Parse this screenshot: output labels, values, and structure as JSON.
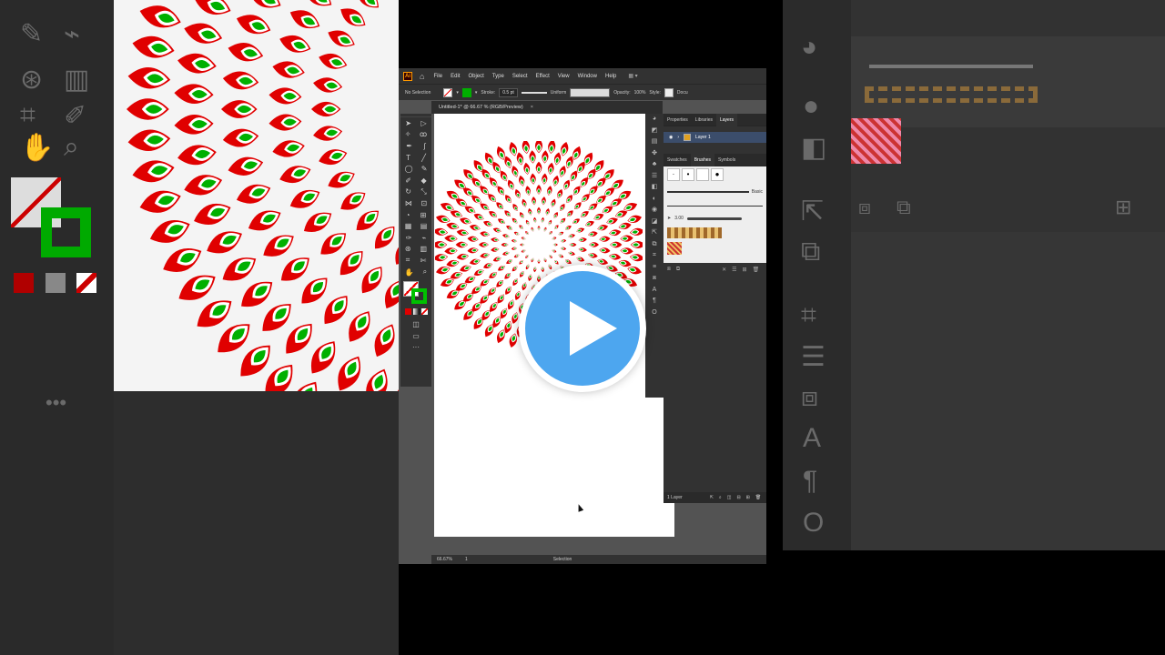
{
  "menubar": {
    "logo": "Ai",
    "items": [
      "File",
      "Edit",
      "Object",
      "Type",
      "Select",
      "Effect",
      "View",
      "Window",
      "Help"
    ]
  },
  "controlbar": {
    "selection": "No Selection",
    "stroke_label": "Stroke:",
    "stroke_value": "0.5 pt",
    "profile": "Uniform",
    "opacity_label": "Opacity:",
    "opacity_value": "100%",
    "style_label": "Style:",
    "doc_label": "Docu"
  },
  "document_tab": {
    "title": "Untitled-1* @ 66.67 % (RGB/Preview)",
    "close": "×"
  },
  "panels": {
    "tabs_top": [
      "Properties",
      "Libraries",
      "Layers"
    ],
    "layer_name": "Layer 1",
    "tabs_bottom": [
      "Swatches",
      "Brushes",
      "Symbols"
    ],
    "brush_basic": "Basic",
    "brush_size": "3.00",
    "footer": "1 Layer"
  },
  "statusbar": {
    "zoom": "66.67%",
    "artboard": "1",
    "tool": "Selection"
  },
  "colors": {
    "red": "#e00000",
    "green": "#00b000",
    "play_blue": "#4da6ef"
  }
}
